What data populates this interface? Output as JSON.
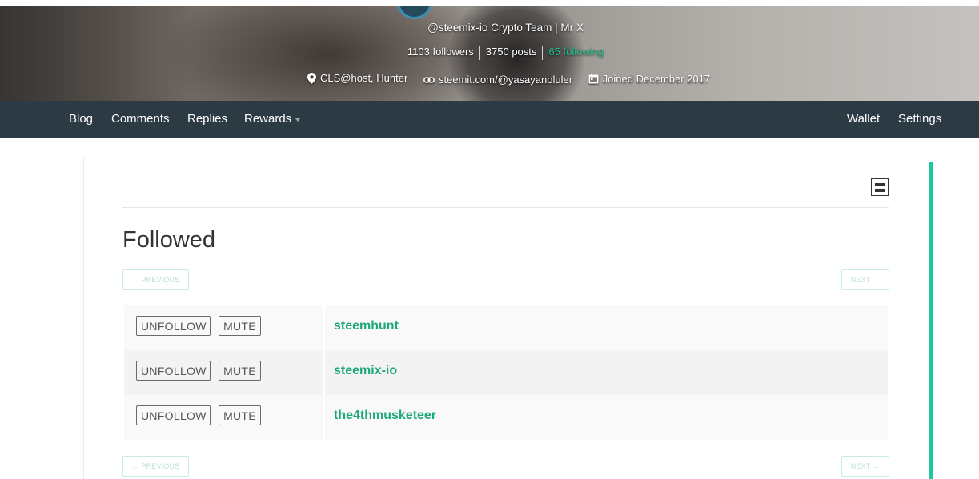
{
  "profile": {
    "tagline": "@steemix-io Crypto Team | Mr X",
    "followers": "1103 followers",
    "posts": "3750 posts",
    "following": "65 following",
    "location": "CLS@host, Hunter",
    "website": "steemit.com/@yasayanoluler",
    "joined": "Joined December 2017"
  },
  "nav": {
    "blog": "Blog",
    "comments": "Comments",
    "replies": "Replies",
    "rewards": "Rewards",
    "wallet": "Wallet",
    "settings": "Settings"
  },
  "main": {
    "title": "Followed",
    "previous": "← PREVIOUS",
    "next": "NEXT →"
  },
  "list": {
    "unfollow_label": "UNFOLLOW",
    "mute_label": "MUTE",
    "users": [
      "steemhunt",
      "steemix-io",
      "the4thmusketeer"
    ]
  },
  "colors": {
    "nav_bg": "#2c3a44",
    "accent": "#1fc4a0",
    "username": "#1fa87d",
    "following_link": "#1fbf8f"
  }
}
